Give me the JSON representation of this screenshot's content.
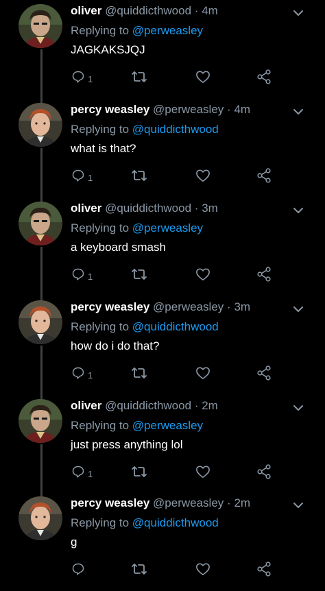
{
  "colors": {
    "background": "#000000",
    "text": "#ffffff",
    "muted": "#8b98a5",
    "accent": "#1d9bf0",
    "thread_line": "#3d4145"
  },
  "tweets": [
    {
      "name": "oliver",
      "handle": "@quiddicthwood",
      "separator": "·",
      "time": "4m",
      "replying_prefix": "Replying to",
      "replying_to": "@perweasley",
      "text": "JAGKAKSJQJ",
      "reply_count": "1",
      "avatar": "oliver-avatar"
    },
    {
      "name": "percy weasley",
      "handle": "@perweasley",
      "separator": "·",
      "time": "4m",
      "replying_prefix": "Replying to",
      "replying_to": "@quiddicthwood",
      "text": "what is that?",
      "reply_count": "1",
      "avatar": "percy-avatar"
    },
    {
      "name": "oliver",
      "handle": "@quiddicthwood",
      "separator": "·",
      "time": "3m",
      "replying_prefix": "Replying to",
      "replying_to": "@perweasley",
      "text": "a keyboard smash",
      "reply_count": "1",
      "avatar": "oliver-avatar"
    },
    {
      "name": "percy weasley",
      "handle": "@perweasley",
      "separator": "·",
      "time": "3m",
      "replying_prefix": "Replying to",
      "replying_to": "@quiddicthwood",
      "text": "how do i do that?",
      "reply_count": "1",
      "avatar": "percy-avatar"
    },
    {
      "name": "oliver",
      "handle": "@quiddicthwood",
      "separator": "·",
      "time": "2m",
      "replying_prefix": "Replying to",
      "replying_to": "@perweasley",
      "text": "just press anything lol",
      "reply_count": "1",
      "avatar": "oliver-avatar"
    },
    {
      "name": "percy weasley",
      "handle": "@perweasley",
      "separator": "·",
      "time": "2m",
      "replying_prefix": "Replying to",
      "replying_to": "@quiddicthwood",
      "text": "g",
      "reply_count": "",
      "avatar": "percy-avatar"
    }
  ]
}
